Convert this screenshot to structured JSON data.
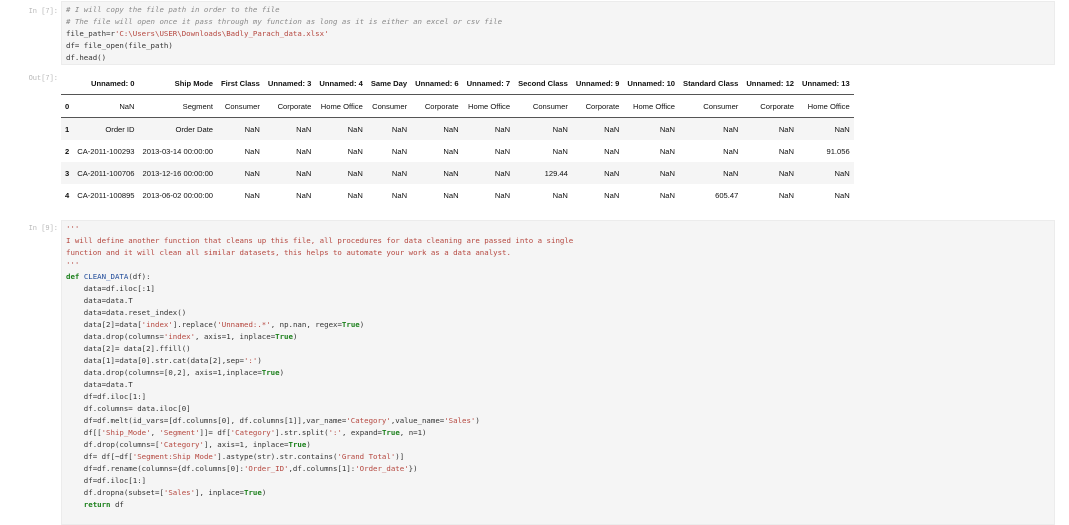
{
  "cell1": {
    "prompt": "In [7]:",
    "lines": [
      [
        {
          "t": "# I will copy the file path in order to the file",
          "c": "c"
        }
      ],
      [
        {
          "t": "# The file will open once it pass through my function as long as it is either an excel or csv file",
          "c": "c"
        }
      ],
      [
        {
          "t": "file_path=r",
          "c": ""
        },
        {
          "t": "'C:\\Users\\USER\\Downloads\\Badly_Parach_data.xlsx'",
          "c": "s"
        }
      ],
      [
        {
          "t": "df= file_open(file_path)",
          "c": ""
        }
      ],
      [
        {
          "t": "df.head()",
          "c": ""
        }
      ]
    ]
  },
  "output1": {
    "prompt": "Out[7]:",
    "columns": [
      "",
      "Unnamed: 0",
      "Ship Mode",
      "First Class",
      "Unnamed: 3",
      "Unnamed: 4",
      "Same Day",
      "Unnamed: 6",
      "Unnamed: 7",
      "Second Class",
      "Unnamed: 9",
      "Unnamed: 10",
      "Standard Class",
      "Unnamed: 12",
      "Unnamed: 13"
    ],
    "rows": [
      [
        "0",
        "NaN",
        "Segment",
        "Consumer",
        "Corporate",
        "Home Office",
        "Consumer",
        "Corporate",
        "Home Office",
        "Consumer",
        "Corporate",
        "Home Office",
        "Consumer",
        "Corporate",
        "Home Office"
      ],
      [
        "1",
        "Order ID",
        "Order Date",
        "NaN",
        "NaN",
        "NaN",
        "NaN",
        "NaN",
        "NaN",
        "NaN",
        "NaN",
        "NaN",
        "NaN",
        "NaN",
        "NaN"
      ],
      [
        "2",
        "CA-2011-100293",
        "2013-03-14 00:00:00",
        "NaN",
        "NaN",
        "NaN",
        "NaN",
        "NaN",
        "NaN",
        "NaN",
        "NaN",
        "NaN",
        "NaN",
        "NaN",
        "91.056"
      ],
      [
        "3",
        "CA-2011-100706",
        "2013-12-16 00:00:00",
        "NaN",
        "NaN",
        "NaN",
        "NaN",
        "NaN",
        "NaN",
        "129.44",
        "NaN",
        "NaN",
        "NaN",
        "NaN",
        "NaN"
      ],
      [
        "4",
        "CA-2011-100895",
        "2013-06-02 00:00:00",
        "NaN",
        "NaN",
        "NaN",
        "NaN",
        "NaN",
        "NaN",
        "NaN",
        "NaN",
        "NaN",
        "605.47",
        "NaN",
        "NaN"
      ]
    ]
  },
  "cell2": {
    "prompt": "In [9]:",
    "lines": [
      [
        {
          "t": "'''",
          "c": "s"
        }
      ],
      [
        {
          "t": "I will define another function that cleans up this file, all procedures for data cleaning are passed into a single",
          "c": "s"
        }
      ],
      [
        {
          "t": "function and it will clean all similar datasets, this helps to automate your work as a data analyst.",
          "c": "s"
        }
      ],
      [
        {
          "t": "'''",
          "c": "s"
        }
      ],
      [
        {
          "t": "def ",
          "c": "k"
        },
        {
          "t": "CLEAN_DATA",
          "c": "f"
        },
        {
          "t": "(df):",
          "c": ""
        }
      ],
      [
        {
          "t": "    data=df.iloc[:1]",
          "c": ""
        }
      ],
      [
        {
          "t": "    data=data.T",
          "c": ""
        }
      ],
      [
        {
          "t": "    data=data.reset_index()",
          "c": ""
        }
      ],
      [
        {
          "t": "    data[2]=data[",
          "c": ""
        },
        {
          "t": "'index'",
          "c": "s"
        },
        {
          "t": "].replace(",
          "c": ""
        },
        {
          "t": "'Unnamed:.*'",
          "c": "s"
        },
        {
          "t": ", np.nan, regex=",
          "c": ""
        },
        {
          "t": "True",
          "c": "k"
        },
        {
          "t": ")",
          "c": ""
        }
      ],
      [
        {
          "t": "    data.drop(columns=",
          "c": ""
        },
        {
          "t": "'index'",
          "c": "s"
        },
        {
          "t": ", axis=1, inplace=",
          "c": ""
        },
        {
          "t": "True",
          "c": "k"
        },
        {
          "t": ")",
          "c": ""
        }
      ],
      [
        {
          "t": "    data[2]= data[2].ffill()",
          "c": ""
        }
      ],
      [
        {
          "t": "    data[1]=data[0].str.cat(data[2],sep=",
          "c": ""
        },
        {
          "t": "':'",
          "c": "s"
        },
        {
          "t": ")",
          "c": ""
        }
      ],
      [
        {
          "t": "    data.drop(columns=[0,2], axis=1,inplace=",
          "c": ""
        },
        {
          "t": "True",
          "c": "k"
        },
        {
          "t": ")",
          "c": ""
        }
      ],
      [
        {
          "t": "    data=data.T",
          "c": ""
        }
      ],
      [
        {
          "t": "    df=df.iloc[1:]",
          "c": ""
        }
      ],
      [
        {
          "t": "    df.columns= data.iloc[0]",
          "c": ""
        }
      ],
      [
        {
          "t": "    df=df.melt(id_vars=[df.columns[0], df.columns[1]],var_name=",
          "c": ""
        },
        {
          "t": "'Category'",
          "c": "s"
        },
        {
          "t": ",value_name=",
          "c": ""
        },
        {
          "t": "'Sales'",
          "c": "s"
        },
        {
          "t": ")",
          "c": ""
        }
      ],
      [
        {
          "t": "    df[[",
          "c": ""
        },
        {
          "t": "'Ship_Mode'",
          "c": "s"
        },
        {
          "t": ", ",
          "c": ""
        },
        {
          "t": "'Segment'",
          "c": "s"
        },
        {
          "t": "]]= df[",
          "c": ""
        },
        {
          "t": "'Category'",
          "c": "s"
        },
        {
          "t": "].str.split(",
          "c": ""
        },
        {
          "t": "':'",
          "c": "s"
        },
        {
          "t": ", expand=",
          "c": ""
        },
        {
          "t": "True",
          "c": "k"
        },
        {
          "t": ", n=1)",
          "c": ""
        }
      ],
      [
        {
          "t": "    df.drop(columns=[",
          "c": ""
        },
        {
          "t": "'Category'",
          "c": "s"
        },
        {
          "t": "], axis=1, inplace=",
          "c": ""
        },
        {
          "t": "True",
          "c": "k"
        },
        {
          "t": ")",
          "c": ""
        }
      ],
      [
        {
          "t": "    df= df[~df[",
          "c": ""
        },
        {
          "t": "'Segment:Ship Mode'",
          "c": "s"
        },
        {
          "t": "].astype(str).str.contains(",
          "c": ""
        },
        {
          "t": "'Grand Total'",
          "c": "s"
        },
        {
          "t": ")]",
          "c": ""
        }
      ],
      [
        {
          "t": "    df=df.rename(columns={df.columns[0]:",
          "c": ""
        },
        {
          "t": "'Order_ID'",
          "c": "s"
        },
        {
          "t": ",df.columns[1]:",
          "c": ""
        },
        {
          "t": "'Order_date'",
          "c": "s"
        },
        {
          "t": "})",
          "c": ""
        }
      ],
      [
        {
          "t": "    df=df.iloc[1:]",
          "c": ""
        }
      ],
      [
        {
          "t": "    df.dropna(subset=[",
          "c": ""
        },
        {
          "t": "'Sales'",
          "c": "s"
        },
        {
          "t": "], inplace=",
          "c": ""
        },
        {
          "t": "True",
          "c": "k"
        },
        {
          "t": ")",
          "c": ""
        }
      ],
      [
        {
          "t": "    return ",
          "c": "k"
        },
        {
          "t": "df",
          "c": ""
        }
      ]
    ]
  },
  "colors": {
    "comment": "#8a8a8a",
    "string": "#b5473f",
    "keyword": "#1a7f1a",
    "cell_bg": "#f5f5f5"
  }
}
